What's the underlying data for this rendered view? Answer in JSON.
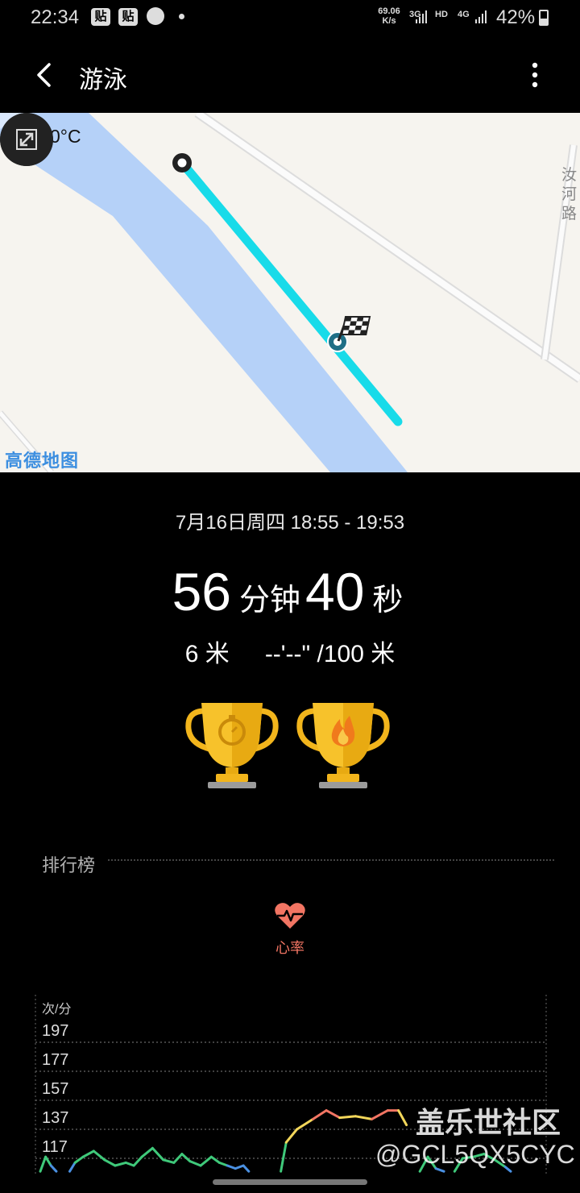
{
  "status_bar": {
    "time": "22:34",
    "badges": [
      "贴",
      "贴"
    ],
    "net_speed_value": "69.06",
    "net_speed_unit": "K/s",
    "net1": "3G",
    "hd": "HD",
    "net2": "4G",
    "battery": "42%"
  },
  "app_bar": {
    "title": "游泳"
  },
  "map": {
    "weather": "28.0°C",
    "road_label": "汝河路",
    "logo": "高德地图",
    "icons": [
      "cloud-icon",
      "expand-icon",
      "start-marker",
      "finish-flag-icon"
    ]
  },
  "workout": {
    "date_range": "7月16日周四 18:55 - 19:53",
    "duration_minutes": "56",
    "minutes_unit": "分钟",
    "duration_seconds": "40",
    "seconds_unit": "秒",
    "distance": "6 米",
    "pace": "--'--\" /100 米"
  },
  "trophies": [
    "stopwatch-trophy-icon",
    "flame-trophy-icon"
  ],
  "leaderboard": {
    "title": "排行榜",
    "metric_label": "心率"
  },
  "chart_data": {
    "type": "line",
    "ylabel": "次/分",
    "yticks": [
      197,
      177,
      157,
      137,
      117
    ],
    "ylim": [
      107,
      205
    ],
    "series": [
      {
        "segment": 1,
        "points": [
          [
            0,
            108
          ],
          [
            2,
            118
          ],
          [
            4,
            112
          ],
          [
            6,
            108
          ]
        ]
      },
      {
        "segment": 2,
        "points": [
          [
            11,
            108
          ],
          [
            13,
            114
          ],
          [
            16,
            118
          ],
          [
            20,
            122
          ],
          [
            24,
            116
          ],
          [
            28,
            112
          ],
          [
            32,
            114
          ],
          [
            35,
            112
          ],
          [
            38,
            118
          ],
          [
            42,
            124
          ],
          [
            46,
            116
          ],
          [
            50,
            114
          ],
          [
            53,
            120
          ],
          [
            56,
            115
          ],
          [
            60,
            112
          ],
          [
            64,
            118
          ],
          [
            67,
            114
          ],
          [
            70,
            112
          ],
          [
            73,
            110
          ],
          [
            76,
            112
          ],
          [
            78,
            108
          ]
        ]
      },
      {
        "segment": 3,
        "points": [
          [
            90,
            108
          ],
          [
            92,
            128
          ],
          [
            96,
            137
          ],
          [
            102,
            144
          ],
          [
            107,
            150
          ],
          [
            112,
            145
          ],
          [
            118,
            146
          ],
          [
            124,
            144
          ],
          [
            130,
            150
          ],
          [
            134,
            150
          ],
          [
            137,
            140
          ]
        ]
      },
      {
        "segment": 4,
        "points": [
          [
            142,
            108
          ],
          [
            145,
            118
          ],
          [
            148,
            110
          ],
          [
            151,
            108
          ]
        ]
      },
      {
        "segment": 5,
        "points": [
          [
            155,
            108
          ],
          [
            158,
            117
          ],
          [
            162,
            118
          ],
          [
            166,
            120
          ],
          [
            170,
            116
          ],
          [
            174,
            111
          ],
          [
            176,
            108
          ]
        ]
      }
    ],
    "colors": {
      "low": "#4a90e2",
      "mid": "#3fc97a",
      "high": "#f2d65a",
      "peak": "#f27563"
    }
  }
}
